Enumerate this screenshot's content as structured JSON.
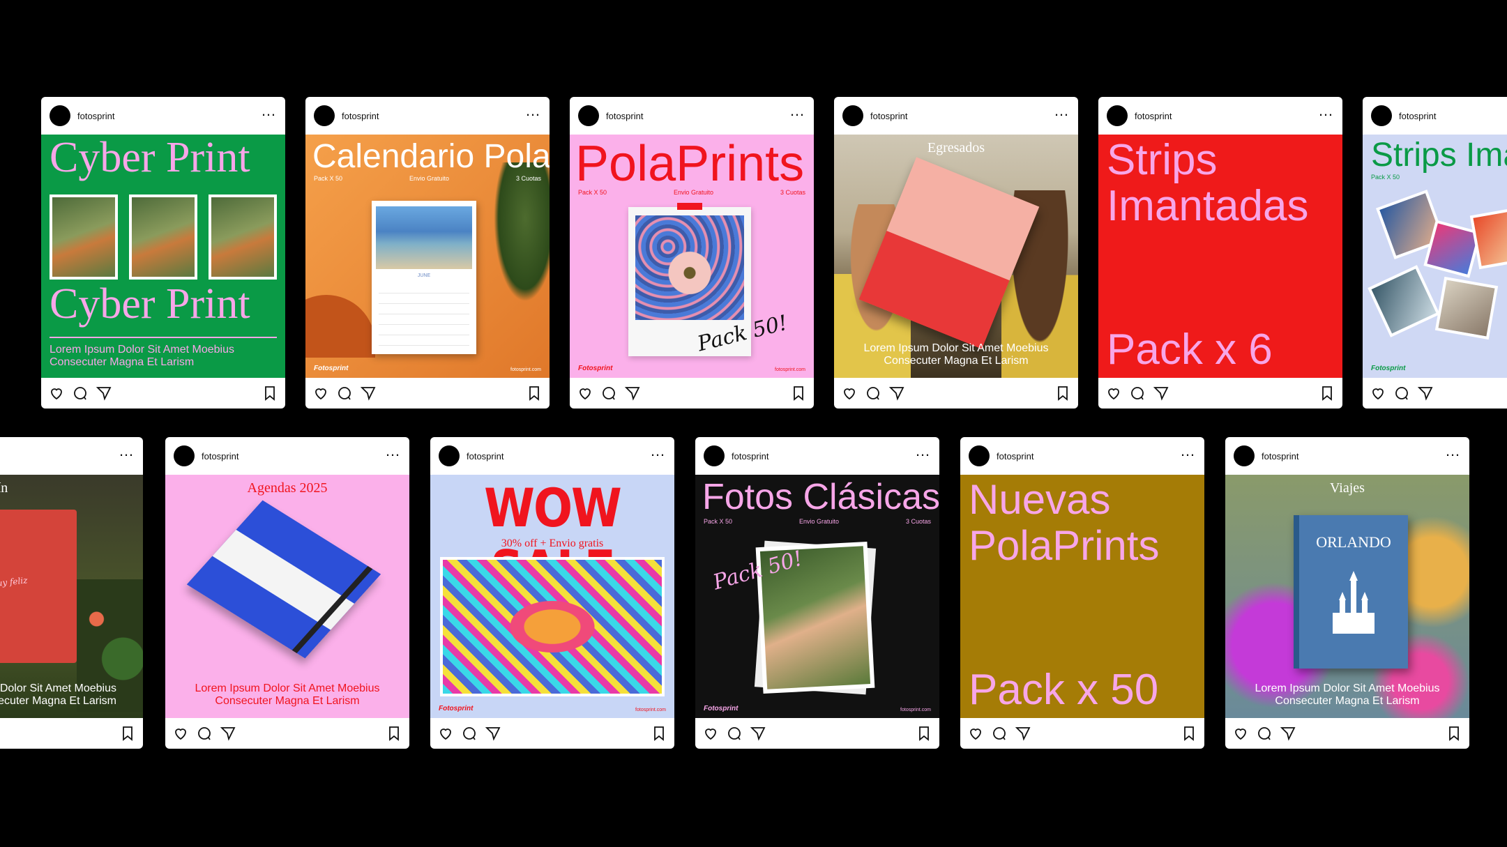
{
  "account": "fotosprint",
  "more_label": "…",
  "lorem1": "Lorem Ipsum Dolor Sit Amet Moebius",
  "lorem2": "Consecuter Magna Et Larism",
  "brand": "Fotosprint",
  "site": "fotosprint.com",
  "pack50": "Pack X 50",
  "envio": "Envio Gratuito",
  "cuotas": "3 Cuotas",
  "posts": {
    "cyber": {
      "title": "Cyber Print",
      "bg": "#0a9a46",
      "text_color": "#f7a6e8"
    },
    "calendario": {
      "title": "Calendario Pola",
      "bg": "#f1913c",
      "month": "JUNE"
    },
    "polaprints": {
      "title": "PolaPrints",
      "bg": "#fbb0ea",
      "accent": "#f0141e",
      "tag": "Pack 50!"
    },
    "egresados": {
      "title": "Egresados"
    },
    "strips": {
      "title1": "Strips",
      "title2": "Imantadas",
      "footer": "Pack x 6",
      "bg": "#ef1a1a",
      "text_color": "#f7a6e8"
    },
    "strips2": {
      "title": "Strips Imantadas",
      "bg": "#cfd8f4"
    },
    "valentin": {
      "title": "San Valentín",
      "script": "te hacés muy feliz"
    },
    "agendas": {
      "title": "Agendas 2025",
      "bg": "#fbb0ea"
    },
    "wowsale": {
      "title": "WOW SALE",
      "subtitle": "30% off + Envio gratis",
      "bg": "#c8d6f6"
    },
    "fotos": {
      "title": "Fotos Clásicas",
      "bg": "#111111",
      "tag": "Pack 50!"
    },
    "nuevas": {
      "title1": "Nuevas",
      "title2": "PolaPrints",
      "footer": "Pack x 50",
      "bg": "#a57c06"
    },
    "viajes": {
      "title": "Viajes",
      "book": "ORLANDO"
    }
  }
}
